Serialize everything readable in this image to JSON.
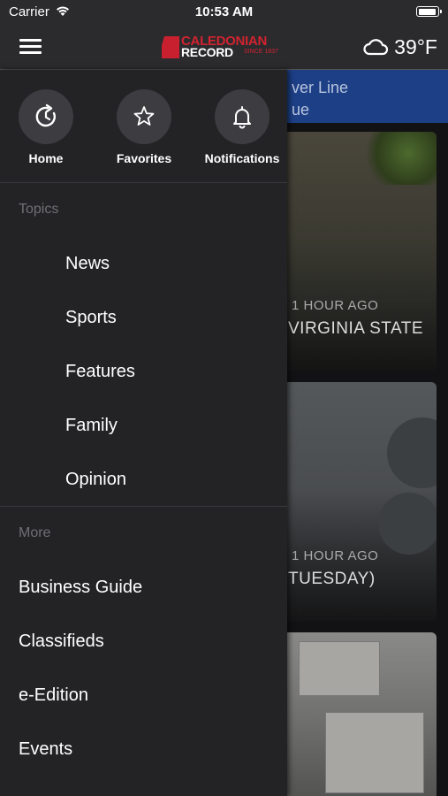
{
  "status_bar": {
    "carrier": "Carrier",
    "time": "10:53 AM"
  },
  "header": {
    "logo": {
      "line1": "CALEDONIAN",
      "line2": "RECORD",
      "tagline": "SINCE 1837"
    },
    "weather": {
      "icon": "cloud-icon",
      "temperature": "39°F"
    }
  },
  "background": {
    "banner": {
      "line1": "ver Line",
      "line2": "ue"
    },
    "cards": [
      {
        "time": "1 HOUR AGO",
        "headline": "VIRGINIA STATE"
      },
      {
        "time": "1 HOUR AGO",
        "headline": "TUESDAY)"
      }
    ]
  },
  "drawer": {
    "quick_actions": [
      {
        "label": "Home",
        "icon": "home-refresh-icon"
      },
      {
        "label": "Favorites",
        "icon": "star-icon"
      },
      {
        "label": "Notifications",
        "icon": "bell-icon"
      }
    ],
    "topics_heading": "Topics",
    "topics": [
      "News",
      "Sports",
      "Features",
      "Family",
      "Opinion"
    ],
    "more_heading": "More",
    "more": [
      "Business Guide",
      "Classifieds",
      "e-Edition",
      "Events"
    ]
  },
  "colors": {
    "brand_red": "#d2232f",
    "drawer_bg": "#232326",
    "banner_blue": "#1d3f86"
  }
}
